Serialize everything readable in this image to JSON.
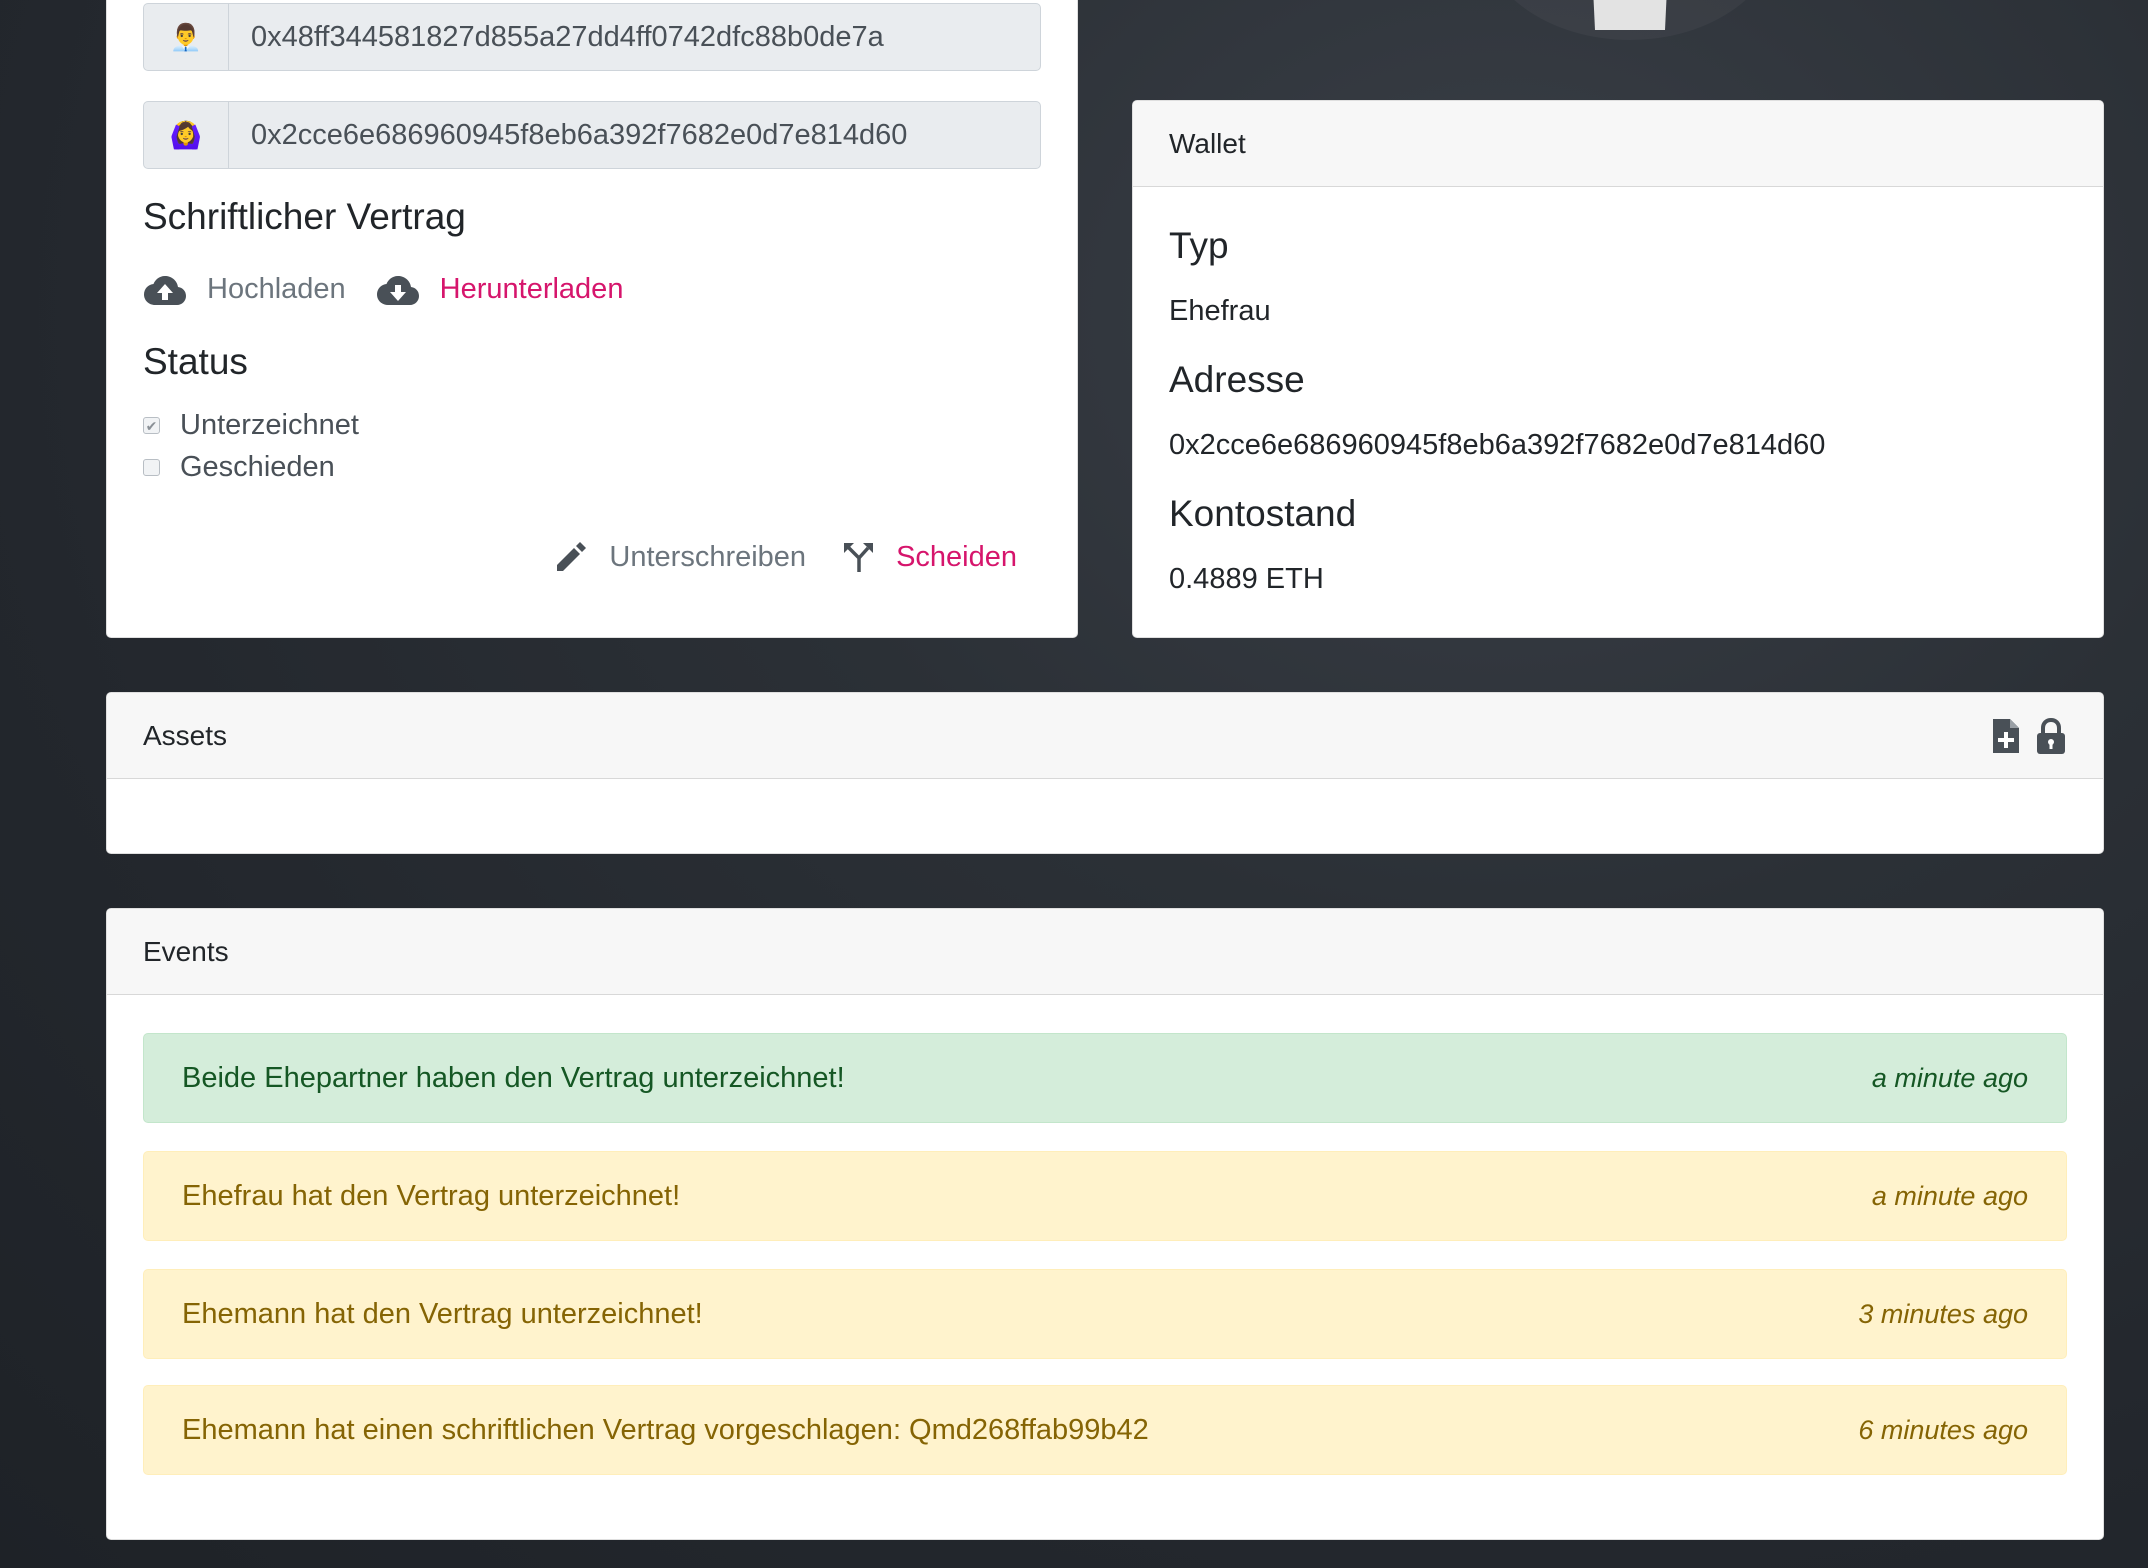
{
  "contract": {
    "husband_icon": "👨‍💼",
    "husband_address": "0x48ff344581827d855a27dd4ff0742dfc88b0de7a",
    "wife_icon": "🙆‍♀️",
    "wife_address": "0x2cce6e686960945f8eb6a392f7682e0d7e814d60",
    "written_title": "Schriftlicher Vertrag",
    "upload_label": "Hochladen",
    "download_label": "Herunterladen",
    "status_title": "Status",
    "statuses": [
      {
        "label": "Unterzeichnet",
        "checked": true
      },
      {
        "label": "Geschieden",
        "checked": false
      }
    ],
    "sign_label": "Unterschreiben",
    "divorce_label": "Scheiden"
  },
  "wallet": {
    "header": "Wallet",
    "type_label": "Typ",
    "type_value": "Ehefrau",
    "address_label": "Adresse",
    "address_value": "0x2cce6e686960945f8eb6a392f7682e0d7e814d60",
    "balance_label": "Kontostand",
    "balance_value": "0.4889 ETH"
  },
  "assets": {
    "header": "Assets"
  },
  "events": {
    "header": "Events",
    "items": [
      {
        "text": "Beide Ehepartner haben den Vertrag unterzeichnet!",
        "time": "a minute ago",
        "variant": "success"
      },
      {
        "text": "Ehefrau hat den Vertrag unterzeichnet!",
        "time": "a minute ago",
        "variant": "warning"
      },
      {
        "text": "Ehemann hat den Vertrag unterzeichnet!",
        "time": "3 minutes ago",
        "variant": "warning"
      },
      {
        "text": "Ehemann hat einen schriftlichen Vertrag vorgeschlagen: Qmd268ffab99b42",
        "time": "6 minutes ago",
        "variant": "warning"
      }
    ]
  },
  "colors": {
    "accent_pink": "#d6156c",
    "success_bg": "#d4edda",
    "warning_bg": "#fff3cd"
  }
}
